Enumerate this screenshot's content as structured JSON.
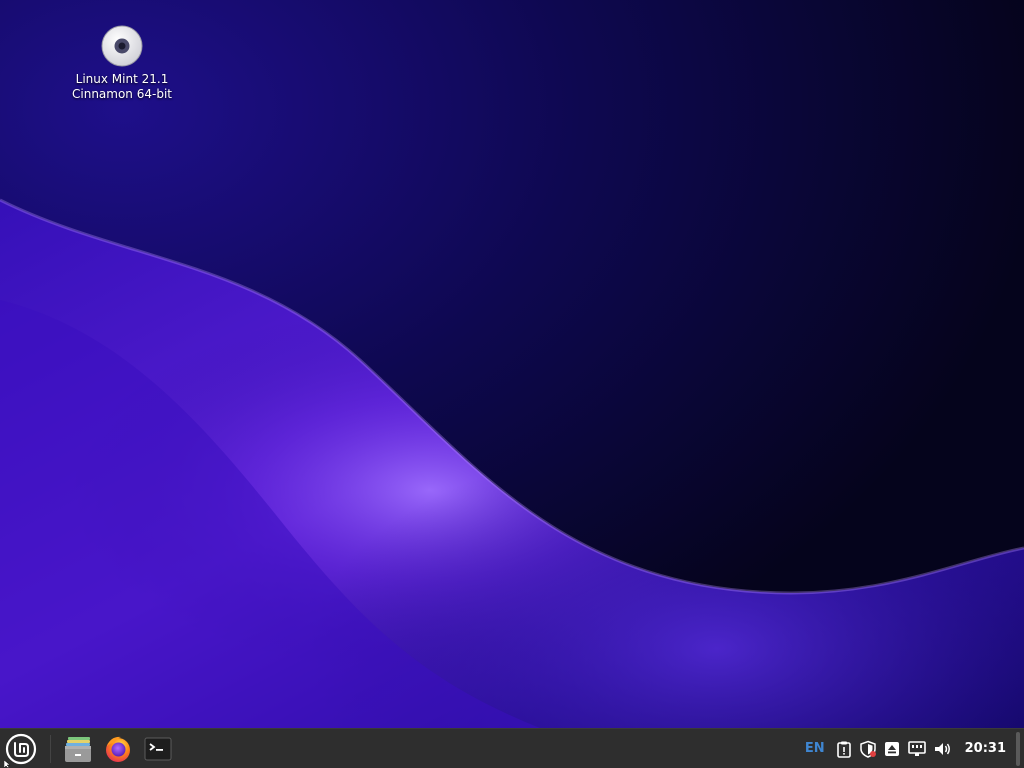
{
  "desktop": {
    "icons": [
      {
        "line1": "Linux Mint 21.1",
        "line2": "Cinnamon 64-bit",
        "icon": "disc-icon"
      }
    ]
  },
  "panel": {
    "menu": {
      "icon": "mint-menu-icon"
    },
    "launchers": [
      {
        "icon": "file-manager-icon"
      },
      {
        "icon": "firefox-icon"
      },
      {
        "icon": "terminal-icon"
      }
    ],
    "tray": {
      "keyboard_layout": "EN",
      "clock": "20:31",
      "icons": [
        "clipboard-icon",
        "update-manager-shield-icon",
        "removable-drive-icon",
        "network-icon",
        "volume-icon"
      ]
    }
  },
  "colors": {
    "panel_bg": "#2e2e2e",
    "kbd_layout": "#3f86d1",
    "wallpaper_dark": "#0b0630",
    "wallpaper_purple": "#7a3fe0"
  }
}
